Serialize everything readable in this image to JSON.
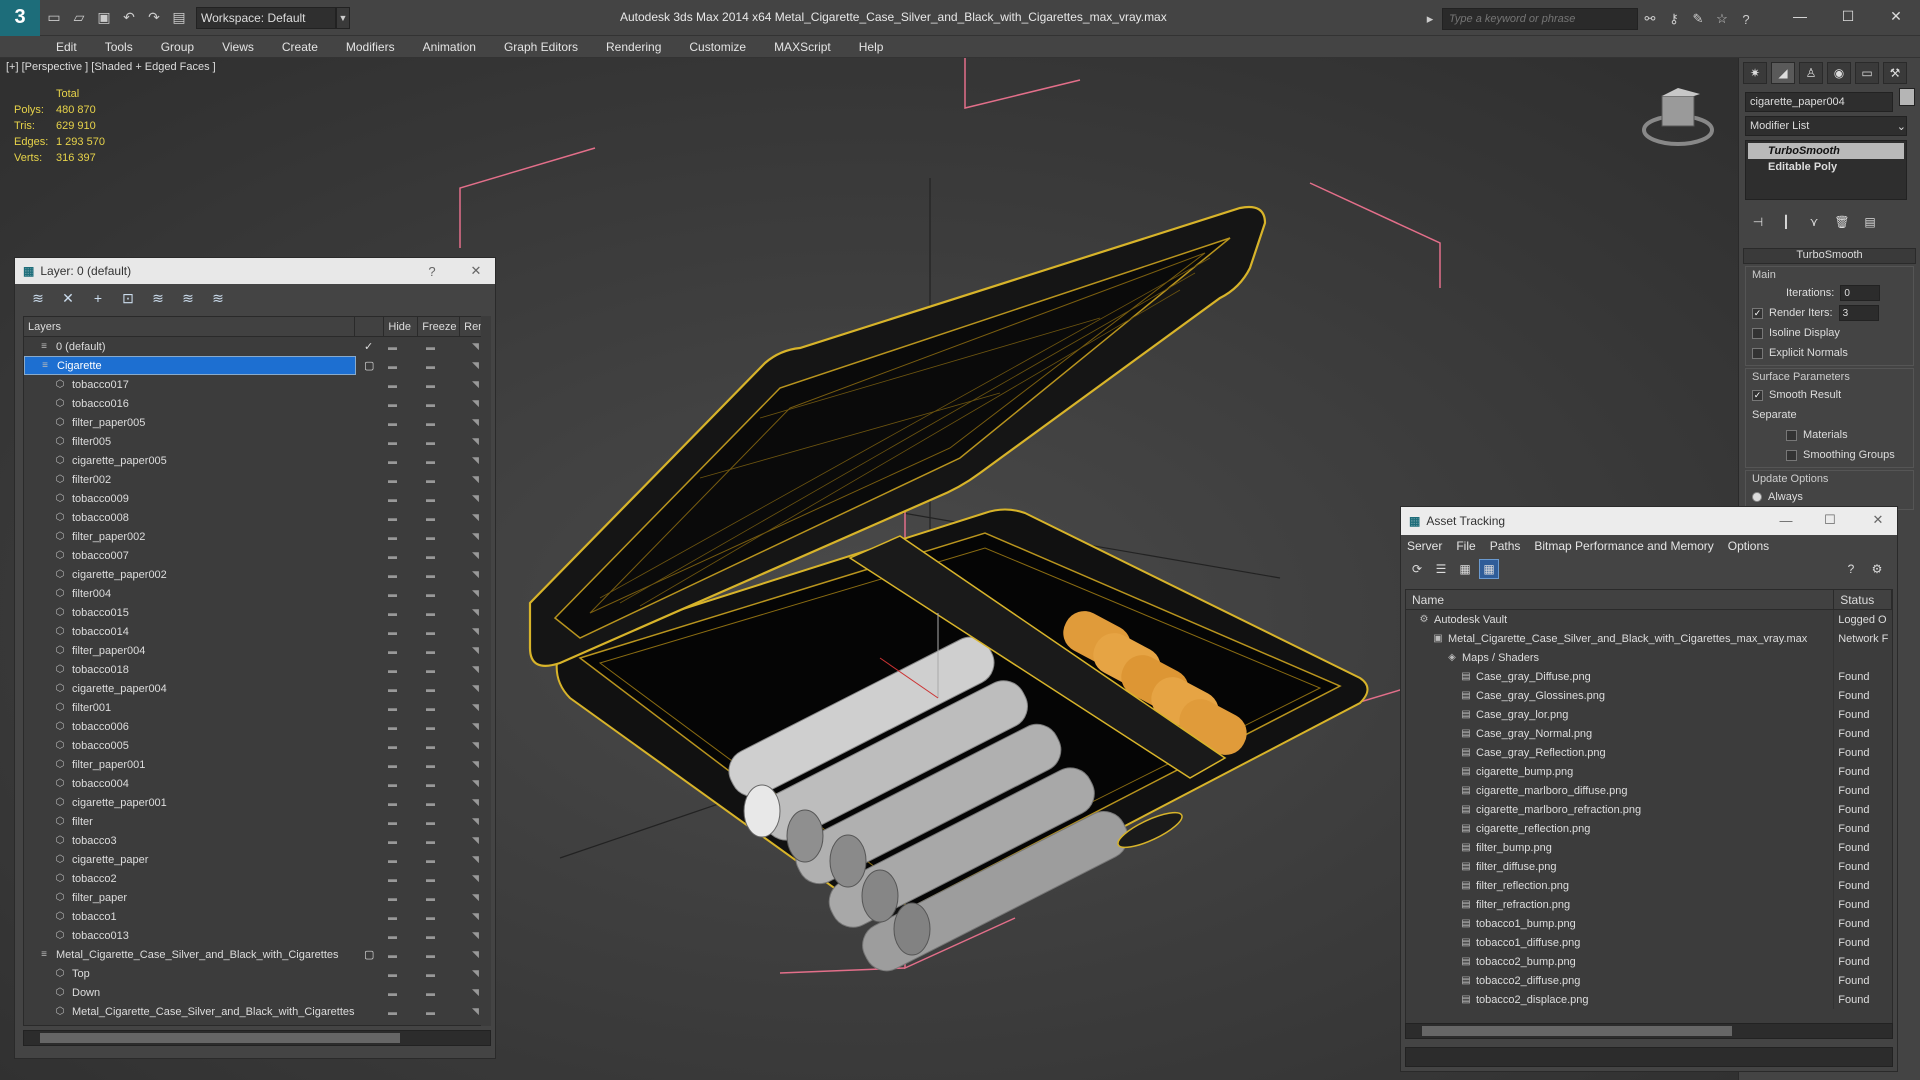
{
  "titlebar": {
    "workspace": "Workspace: Default",
    "title": "Autodesk 3ds Max  2014 x64      Metal_Cigarette_Case_Silver_and_Black_with_Cigarettes_max_vray.max",
    "search_placeholder": "Type a keyword or phrase"
  },
  "menu": [
    "Edit",
    "Tools",
    "Group",
    "Views",
    "Create",
    "Modifiers",
    "Animation",
    "Graph Editors",
    "Rendering",
    "Customize",
    "MAXScript",
    "Help"
  ],
  "viewport": {
    "label": "[+] [Perspective ] [Shaded + Edged Faces ]",
    "stats": {
      "header": "Total",
      "polys_label": "Polys:",
      "polys": "480 870",
      "tris_label": "Tris:",
      "tris": "629 910",
      "edges_label": "Edges:",
      "edges": "1 293 570",
      "verts_label": "Verts:",
      "verts": "316 397"
    },
    "colors": {
      "wire": "#d8b42a",
      "bbox": "#e36f8a",
      "filter": "#e09b3a",
      "paper": "#cfcfcf"
    }
  },
  "cmdpanel": {
    "object_name": "cigarette_paper004",
    "modifier_list": "Modifier List",
    "stack": [
      "TurboSmooth",
      "Editable Poly"
    ],
    "rollout": "TurboSmooth",
    "main_group": "Main",
    "iterations_label": "Iterations:",
    "iterations": "0",
    "render_iters_label": "Render Iters:",
    "render_iters": "3",
    "isoline": "Isoline Display",
    "explicit_normals": "Explicit Normals",
    "surface_group": "Surface Parameters",
    "smooth_result": "Smooth Result",
    "separate": "Separate",
    "materials": "Materials",
    "smoothing_groups": "Smoothing Groups",
    "update_group": "Update Options",
    "always": "Always"
  },
  "layer_window": {
    "title": "Layer: 0 (default)",
    "help": "?",
    "columns": {
      "layers": "Layers",
      "hide": "Hide",
      "freeze": "Freeze",
      "render": "Ren"
    },
    "rows": [
      {
        "name": "0 (default)",
        "level": 1
      },
      {
        "name": "Cigarette",
        "level": 1
      },
      {
        "name": "tobacco017",
        "level": 2
      },
      {
        "name": "tobacco016",
        "level": 2
      },
      {
        "name": "filter_paper005",
        "level": 2
      },
      {
        "name": "filter005",
        "level": 2
      },
      {
        "name": "cigarette_paper005",
        "level": 2
      },
      {
        "name": "filter002",
        "level": 2
      },
      {
        "name": "tobacco009",
        "level": 2
      },
      {
        "name": "tobacco008",
        "level": 2
      },
      {
        "name": "filter_paper002",
        "level": 2
      },
      {
        "name": "tobacco007",
        "level": 2
      },
      {
        "name": "cigarette_paper002",
        "level": 2
      },
      {
        "name": "filter004",
        "level": 2
      },
      {
        "name": "tobacco015",
        "level": 2
      },
      {
        "name": "tobacco014",
        "level": 2
      },
      {
        "name": "filter_paper004",
        "level": 2
      },
      {
        "name": "tobacco018",
        "level": 2
      },
      {
        "name": "cigarette_paper004",
        "level": 2
      },
      {
        "name": "filter001",
        "level": 2
      },
      {
        "name": "tobacco006",
        "level": 2
      },
      {
        "name": "tobacco005",
        "level": 2
      },
      {
        "name": "filter_paper001",
        "level": 2
      },
      {
        "name": "tobacco004",
        "level": 2
      },
      {
        "name": "cigarette_paper001",
        "level": 2
      },
      {
        "name": "filter",
        "level": 2
      },
      {
        "name": "tobacco3",
        "level": 2
      },
      {
        "name": "cigarette_paper",
        "level": 2
      },
      {
        "name": "tobacco2",
        "level": 2
      },
      {
        "name": "filter_paper",
        "level": 2
      },
      {
        "name": "tobacco1",
        "level": 2
      },
      {
        "name": "tobacco013",
        "level": 2
      },
      {
        "name": "Metal_Cigarette_Case_Silver_and_Black_with_Cigarettes",
        "level": 1
      },
      {
        "name": "Top",
        "level": 2
      },
      {
        "name": "Down",
        "level": 2
      },
      {
        "name": "Metal_Cigarette_Case_Silver_and_Black_with_Cigarettes",
        "level": 2
      }
    ]
  },
  "asset_window": {
    "title": "Asset Tracking",
    "menu": [
      "Server",
      "File",
      "Paths",
      "Bitmap Performance and Memory",
      "Options"
    ],
    "columns": {
      "name": "Name",
      "status": "Status"
    },
    "rows": [
      {
        "name": "Autodesk Vault",
        "status": "Logged O",
        "level": 1
      },
      {
        "name": "Metal_Cigarette_Case_Silver_and_Black_with_Cigarettes_max_vray.max",
        "status": "Network F",
        "level": 2
      },
      {
        "name": "Maps / Shaders",
        "status": "",
        "level": 3
      },
      {
        "name": "Case_gray_Diffuse.png",
        "status": "Found",
        "level": 4
      },
      {
        "name": "Case_gray_Glossines.png",
        "status": "Found",
        "level": 4
      },
      {
        "name": "Case_gray_lor.png",
        "status": "Found",
        "level": 4
      },
      {
        "name": "Case_gray_Normal.png",
        "status": "Found",
        "level": 4
      },
      {
        "name": "Case_gray_Reflection.png",
        "status": "Found",
        "level": 4
      },
      {
        "name": "cigarette_bump.png",
        "status": "Found",
        "level": 4
      },
      {
        "name": "cigarette_marlboro_diffuse.png",
        "status": "Found",
        "level": 4
      },
      {
        "name": "cigarette_marlboro_refraction.png",
        "status": "Found",
        "level": 4
      },
      {
        "name": "cigarette_reflection.png",
        "status": "Found",
        "level": 4
      },
      {
        "name": "filter_bump.png",
        "status": "Found",
        "level": 4
      },
      {
        "name": "filter_diffuse.png",
        "status": "Found",
        "level": 4
      },
      {
        "name": "filter_reflection.png",
        "status": "Found",
        "level": 4
      },
      {
        "name": "filter_refraction.png",
        "status": "Found",
        "level": 4
      },
      {
        "name": "tobacco1_bump.png",
        "status": "Found",
        "level": 4
      },
      {
        "name": "tobacco1_diffuse.png",
        "status": "Found",
        "level": 4
      },
      {
        "name": "tobacco2_bump.png",
        "status": "Found",
        "level": 4
      },
      {
        "name": "tobacco2_diffuse.png",
        "status": "Found",
        "level": 4
      },
      {
        "name": "tobacco2_displace.png",
        "status": "Found",
        "level": 4
      }
    ]
  }
}
